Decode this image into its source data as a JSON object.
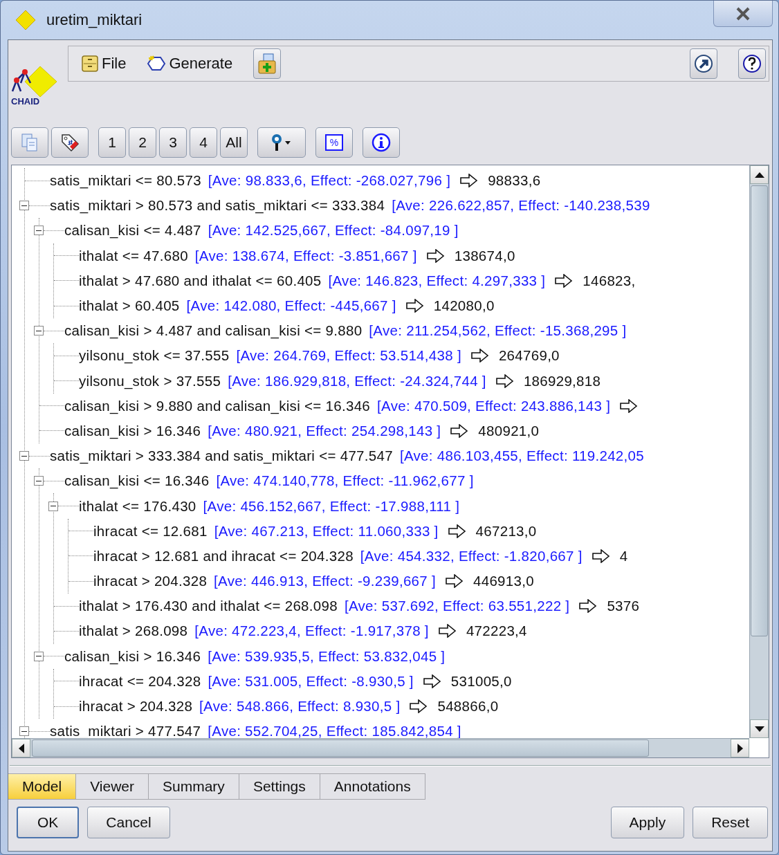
{
  "window": {
    "title": "uretim_miktari"
  },
  "menu": [
    {
      "label": "File",
      "kind": "file"
    },
    {
      "label": "Generate",
      "kind": "generate"
    }
  ],
  "logo": {
    "label": "CHAID"
  },
  "toolbar": [
    {
      "kind": "copy"
    },
    {
      "kind": "tag"
    },
    {
      "kind": "level",
      "label": "1"
    },
    {
      "kind": "level",
      "label": "2"
    },
    {
      "kind": "level",
      "label": "3"
    },
    {
      "kind": "level",
      "label": "4"
    },
    {
      "kind": "level",
      "label": "All"
    },
    {
      "kind": "pin"
    },
    {
      "kind": "percent",
      "label": "%"
    },
    {
      "kind": "info"
    }
  ],
  "tree": [
    {
      "condition": "satis_miktari <= 80.573",
      "stats": "[Ave: 98.833,6, Effect: -268.027,796 ]",
      "arrow": true,
      "result": "98833,6"
    },
    {
      "condition": "satis_miktari > 80.573 and satis_miktari <= 333.384",
      "stats": "[Ave: 226.622,857, Effect: -140.238,539",
      "expanded": true,
      "children": [
        {
          "condition": "calisan_kisi <= 4.487",
          "stats": "[Ave: 142.525,667, Effect: -84.097,19 ]",
          "expanded": true,
          "children": [
            {
              "condition": "ithalat <= 47.680",
              "stats": "[Ave: 138.674, Effect: -3.851,667 ]",
              "arrow": true,
              "result": "138674,0"
            },
            {
              "condition": "ithalat > 47.680 and ithalat <= 60.405",
              "stats": "[Ave: 146.823, Effect: 4.297,333 ]",
              "arrow": true,
              "result": "146823,"
            },
            {
              "condition": "ithalat > 60.405",
              "stats": "[Ave: 142.080, Effect: -445,667 ]",
              "arrow": true,
              "result": "142080,0"
            }
          ]
        },
        {
          "condition": "calisan_kisi > 4.487 and calisan_kisi <= 9.880",
          "stats": "[Ave: 211.254,562, Effect: -15.368,295 ]",
          "expanded": true,
          "children": [
            {
              "condition": "yilsonu_stok <= 37.555",
              "stats": "[Ave: 264.769, Effect: 53.514,438 ]",
              "arrow": true,
              "result": "264769,0"
            },
            {
              "condition": "yilsonu_stok > 37.555",
              "stats": "[Ave: 186.929,818, Effect: -24.324,744 ]",
              "arrow": true,
              "result": "186929,818"
            }
          ]
        },
        {
          "condition": "calisan_kisi > 9.880 and calisan_kisi <= 16.346",
          "stats": "[Ave: 470.509, Effect: 243.886,143 ]",
          "arrow": true
        },
        {
          "condition": "calisan_kisi > 16.346",
          "stats": "[Ave: 480.921, Effect: 254.298,143 ]",
          "arrow": true,
          "result": "480921,0"
        }
      ]
    },
    {
      "condition": "satis_miktari > 333.384 and satis_miktari <= 477.547",
      "stats": "[Ave: 486.103,455, Effect: 119.242,05",
      "expanded": true,
      "children": [
        {
          "condition": "calisan_kisi <= 16.346",
          "stats": "[Ave: 474.140,778, Effect: -11.962,677 ]",
          "expanded": true,
          "children": [
            {
              "condition": "ithalat <= 176.430",
              "stats": "[Ave: 456.152,667, Effect: -17.988,111 ]",
              "expanded": true,
              "children": [
                {
                  "condition": "ihracat <= 12.681",
                  "stats": "[Ave: 467.213, Effect: 11.060,333 ]",
                  "arrow": true,
                  "result": "467213,0"
                },
                {
                  "condition": "ihracat > 12.681 and ihracat <= 204.328",
                  "stats": "[Ave: 454.332, Effect: -1.820,667 ]",
                  "arrow": true,
                  "result": "4"
                },
                {
                  "condition": "ihracat > 204.328",
                  "stats": "[Ave: 446.913, Effect: -9.239,667 ]",
                  "arrow": true,
                  "result": "446913,0"
                }
              ]
            },
            {
              "condition": "ithalat > 176.430 and ithalat <= 268.098",
              "stats": "[Ave: 537.692, Effect: 63.551,222 ]",
              "arrow": true,
              "result": "5376"
            },
            {
              "condition": "ithalat > 268.098",
              "stats": "[Ave: 472.223,4, Effect: -1.917,378 ]",
              "arrow": true,
              "result": "472223,4"
            }
          ]
        },
        {
          "condition": "calisan_kisi > 16.346",
          "stats": "[Ave: 539.935,5, Effect: 53.832,045 ]",
          "expanded": true,
          "children": [
            {
              "condition": "ihracat <= 204.328",
              "stats": "[Ave: 531.005, Effect: -8.930,5 ]",
              "arrow": true,
              "result": "531005,0"
            },
            {
              "condition": "ihracat > 204.328",
              "stats": "[Ave: 548.866, Effect: 8.930,5 ]",
              "arrow": true,
              "result": "548866,0"
            }
          ]
        }
      ]
    },
    {
      "condition": "satis_miktari > 477.547",
      "stats": "[Ave: 552.704,25, Effect: 185.842,854 ]",
      "expanded": true
    }
  ],
  "tabs": [
    {
      "label": "Model",
      "selected": true
    },
    {
      "label": "Viewer",
      "selected": false
    },
    {
      "label": "Summary",
      "selected": false
    },
    {
      "label": "Settings",
      "selected": false
    },
    {
      "label": "Annotations",
      "selected": false
    }
  ],
  "buttons": [
    {
      "label": "OK",
      "default": true
    },
    {
      "label": "Cancel",
      "default": false
    },
    {
      "label": "Apply",
      "default": false
    },
    {
      "label": "Reset",
      "default": false
    }
  ]
}
